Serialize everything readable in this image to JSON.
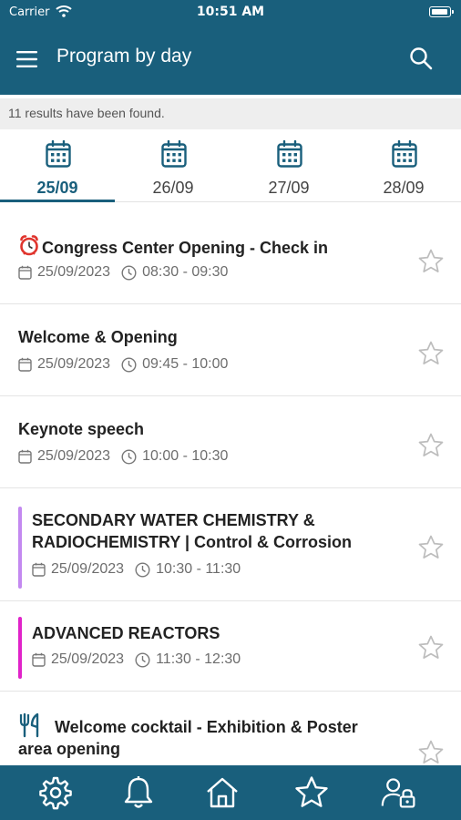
{
  "status_bar": {
    "carrier": "Carrier",
    "time": "10:51 AM"
  },
  "app_bar": {
    "title": "Program by day"
  },
  "results_text": "11 results have been found.",
  "day_tabs": [
    {
      "label": "25/09",
      "active": true
    },
    {
      "label": "26/09",
      "active": false
    },
    {
      "label": "27/09",
      "active": false
    },
    {
      "label": "28/09",
      "active": false
    }
  ],
  "sessions": [
    {
      "title": "Congress Center Opening - Check in",
      "leading_icon": "alarm-clock-icon",
      "date": "25/09/2023",
      "time": "08:30 - 09:30",
      "favorite": false
    },
    {
      "title": "Welcome & Opening",
      "date": "25/09/2023",
      "time": "09:45 - 10:00",
      "favorite": false
    },
    {
      "title": "Keynote speech",
      "date": "25/09/2023",
      "time": "10:00 - 10:30",
      "favorite": false
    },
    {
      "title_line1": "SECONDARY WATER CHEMISTRY &",
      "title_line2": "RADIOCHEMISTRY | Control & Corrosion",
      "track_color": "#c389f0",
      "date": "25/09/2023",
      "time": "10:30 - 11:30",
      "favorite": false
    },
    {
      "title": "ADVANCED REACTORS",
      "track_color": "#e023c9",
      "date": "25/09/2023",
      "time": "11:30 - 12:30",
      "favorite": false
    },
    {
      "title_line1": "Welcome cocktail - Exhibition & Poster",
      "title_line2": "area opening",
      "leading_icon": "fork-knife-icon",
      "favorite": false
    }
  ],
  "bottom_nav": [
    "settings-icon",
    "bell-icon",
    "home-icon",
    "star-icon",
    "user-lock-icon"
  ],
  "colors": {
    "primary": "#195f7c",
    "background_strip": "#eeeeee",
    "secondary_track": "#c389f0",
    "advanced_track": "#e023c9"
  }
}
